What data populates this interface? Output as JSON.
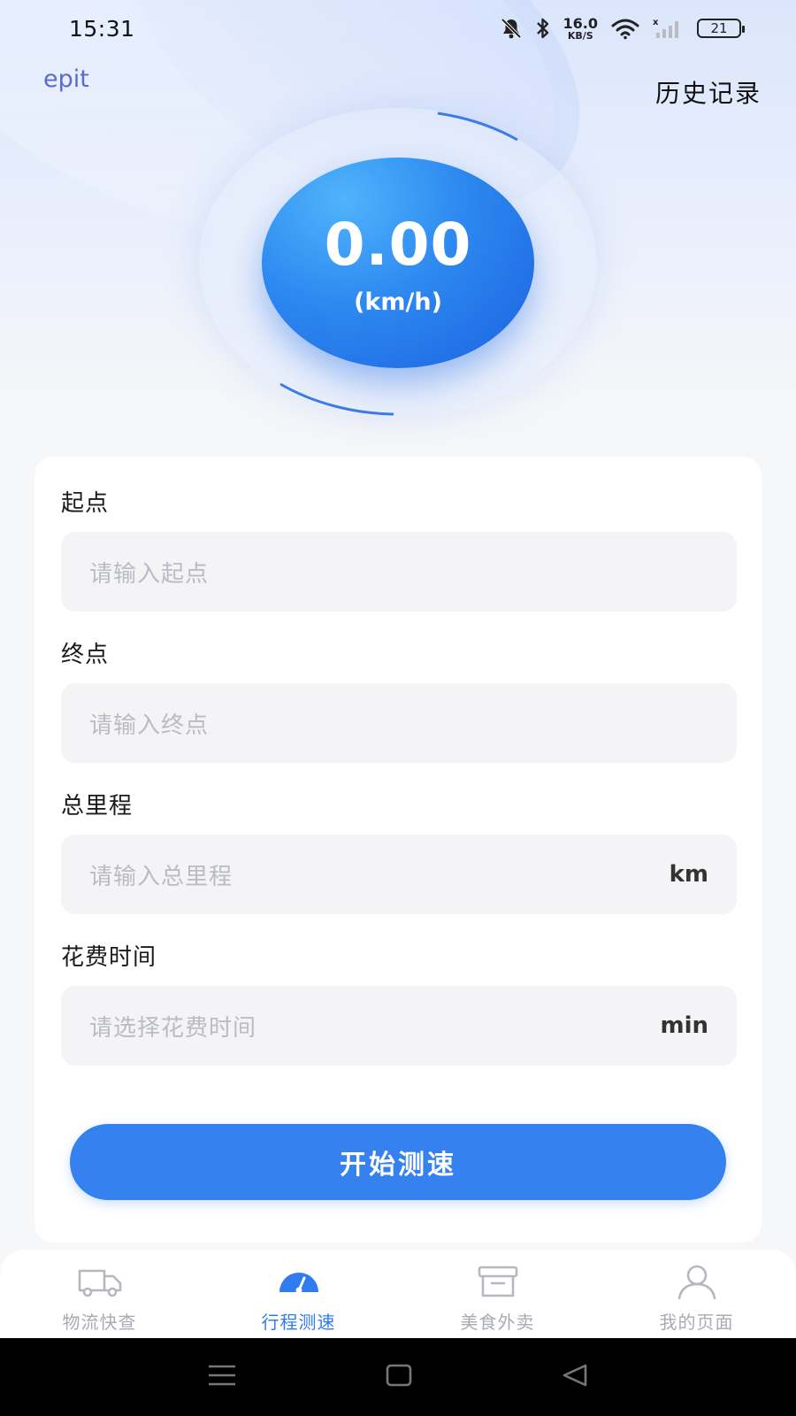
{
  "status_bar": {
    "time": "15:31",
    "net_speed_value": "16.0",
    "net_speed_unit": "KB/S",
    "battery": "21"
  },
  "header": {
    "left_label": "epit",
    "history_label": "历史记录"
  },
  "speed": {
    "value": "0.00",
    "unit": "(km/h)"
  },
  "form": {
    "start": {
      "label": "起点",
      "placeholder": "请输入起点"
    },
    "end": {
      "label": "终点",
      "placeholder": "请输入终点"
    },
    "distance": {
      "label": "总里程",
      "placeholder": "请输入总里程",
      "unit": "km"
    },
    "duration": {
      "label": "花费时间",
      "placeholder": "请选择花费时间",
      "unit": "min"
    },
    "submit_label": "开始测速"
  },
  "tabs": [
    {
      "label": "物流快查",
      "icon": "truck-icon",
      "active": false
    },
    {
      "label": "行程测速",
      "icon": "speedometer-icon",
      "active": true
    },
    {
      "label": "美食外卖",
      "icon": "box-icon",
      "active": false
    },
    {
      "label": "我的页面",
      "icon": "user-icon",
      "active": false
    }
  ],
  "colors": {
    "accent": "#3481ef",
    "tab_active": "#2f7cf0",
    "tab_inactive": "#a8abb3",
    "placeholder": "#b9bcc4"
  }
}
